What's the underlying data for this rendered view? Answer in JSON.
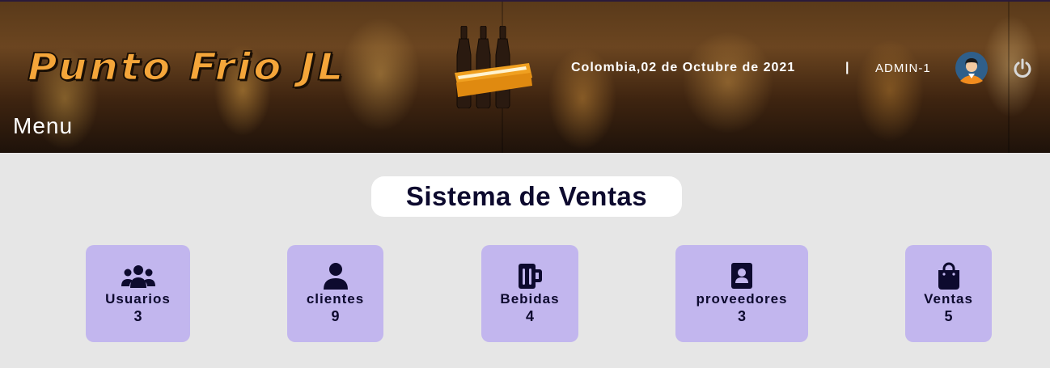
{
  "header": {
    "brand": "Punto Frio JL",
    "menu_label": "Menu",
    "date_text": "Colombia,02 de Octubre de 2021",
    "separator": "|",
    "user": "ADMIN-1",
    "icons": {
      "avatar": "user-avatar-icon",
      "logout": "power-icon",
      "logo": "beer-bottles-logo"
    }
  },
  "main": {
    "title": "Sistema de Ventas",
    "cards": [
      {
        "label": "Usuarios",
        "count": "3",
        "icon": "users-icon"
      },
      {
        "label": "clientes",
        "count": "9",
        "icon": "user-icon"
      },
      {
        "label": "Bebidas",
        "count": "4",
        "icon": "beer-mug-icon"
      },
      {
        "label": "proveedores",
        "count": "3",
        "icon": "contact-card-icon"
      },
      {
        "label": "Ventas",
        "count": "5",
        "icon": "shopping-bag-icon"
      }
    ]
  },
  "colors": {
    "brand_orange": "#f5a63a",
    "card_bg": "#c2b6ee",
    "text_dark": "#0d0a2e",
    "page_bg": "#e6e6e6"
  }
}
